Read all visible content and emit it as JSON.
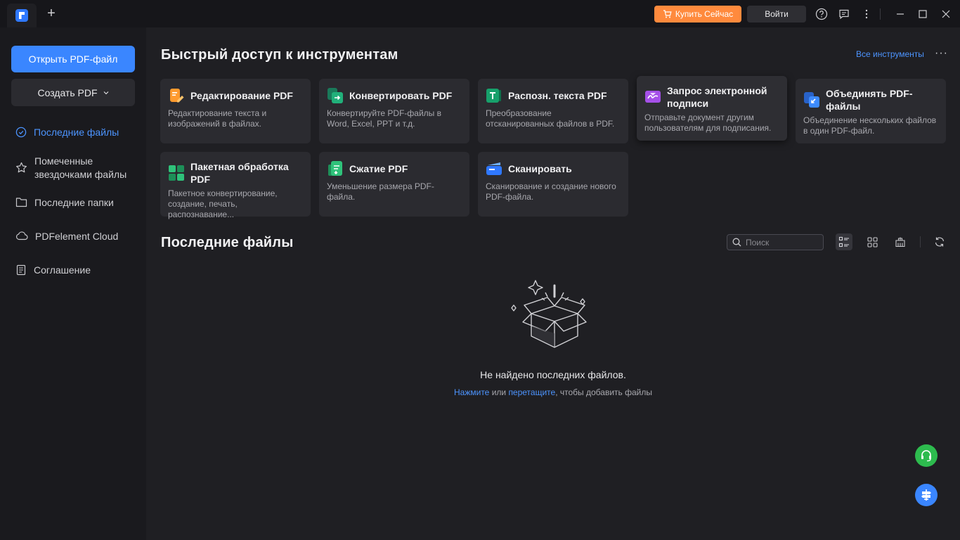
{
  "titlebar": {
    "buy_label": "Купить Сейчас",
    "login_label": "Войти"
  },
  "sidebar": {
    "open_label": "Открыть PDF-файл",
    "create_label": "Создать PDF",
    "items": [
      {
        "label": "Последние файлы",
        "active": true
      },
      {
        "label": "Помеченные звездочками файлы"
      },
      {
        "label": "Последние папки"
      },
      {
        "label": "PDFelement Cloud"
      },
      {
        "label": "Соглашение"
      }
    ]
  },
  "tools": {
    "title": "Быстрый доступ к инструментам",
    "all_label": "Все инструменты",
    "more_label": "···",
    "cards": [
      {
        "title": "Редактирование PDF",
        "desc": "Редактирование текста и изображений в файлах."
      },
      {
        "title": "Конвертировать PDF",
        "desc": "Конвертируйте PDF-файлы в Word, Excel, PPT и т.д."
      },
      {
        "title": "Распозн. текста PDF",
        "desc": "Преобразование отсканированных файлов в PDF."
      },
      {
        "title": "Запрос электронной подписи",
        "desc": "Отправьте документ другим пользователям для подписания."
      },
      {
        "title": "Объединять PDF-файлы",
        "desc": "Объединение нескольких файлов в один PDF-файл."
      },
      {
        "title": "Пакетная обработка PDF",
        "desc": "Пакетное конвертирование, создание, печать, распознавание..."
      },
      {
        "title": "Сжатие PDF",
        "desc": "Уменьшение размера PDF-файла."
      },
      {
        "title": "Сканировать",
        "desc": "Сканирование и создание нового PDF-файла."
      }
    ]
  },
  "recent": {
    "title": "Последние файлы",
    "search_placeholder": "Поиск",
    "empty_text": "Не найдено последних файлов.",
    "hint_click": "Нажмите",
    "hint_or": " или ",
    "hint_drag": "перетащите",
    "hint_rest": ", чтобы добавить файлы"
  },
  "colors": {
    "accent": "#3a86ff",
    "buy": "#ff8a3d",
    "support": "#2dbb4e"
  }
}
